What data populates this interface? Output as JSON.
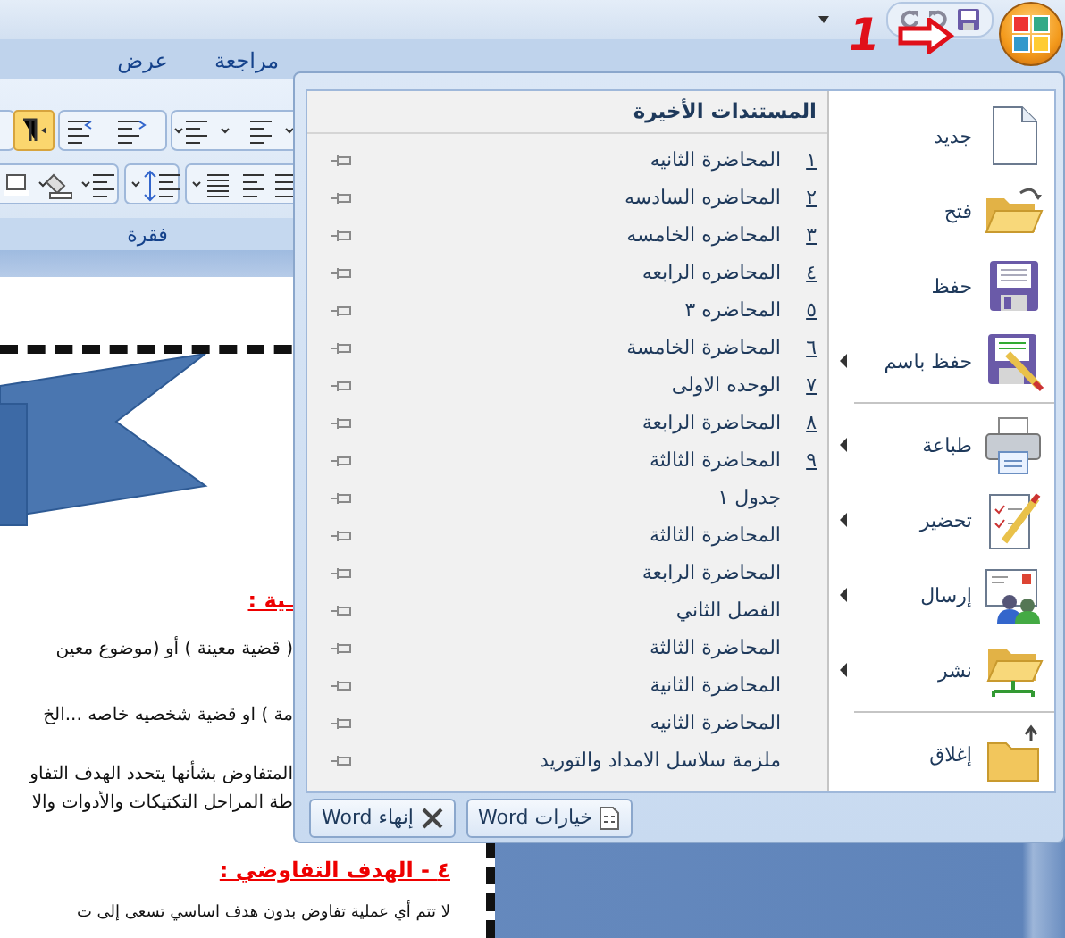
{
  "title_bar": {
    "annotation": "1"
  },
  "ribbon": {
    "tabs": [
      {
        "label": "مراجعة",
        "selected": false
      },
      {
        "label": "عرض",
        "selected": false
      }
    ],
    "group_label": "فقرة"
  },
  "document": {
    "partly_hidden": [
      {
        "kind": "heading",
        "text": "ـية :"
      },
      {
        "kind": "paragraph",
        "text": "( قضية معينة ) أو (موضوع معين"
      },
      {
        "kind": "paragraph",
        "text": "مة ) او قضية شخصيه خاصه ...الخ"
      },
      {
        "kind": "paragraph",
        "text": "المتفاوض بشأنها يتحدد الهدف التفاو"
      },
      {
        "kind": "paragraph",
        "text": "طة المراحل التكتيكات والأدوات والا"
      }
    ],
    "visible": [
      {
        "kind": "heading",
        "text": "٤ - الهدف التفاوضي :"
      },
      {
        "kind": "paragraph",
        "text": "لا تتم أي عملية تفاوض بدون هدف اساسي تسعى إلى ت"
      }
    ]
  },
  "office_menu": {
    "commands": [
      {
        "kind": "new",
        "label": "جديد",
        "submenu": false,
        "separator_after": false
      },
      {
        "kind": "open",
        "label": "فتح",
        "submenu": false,
        "separator_after": false
      },
      {
        "kind": "save",
        "label": "حفظ",
        "submenu": false,
        "separator_after": false
      },
      {
        "kind": "save_as",
        "label": "حفظ باسم",
        "submenu": true,
        "separator_after": true
      },
      {
        "kind": "print",
        "label": "طباعة",
        "submenu": true,
        "separator_after": false
      },
      {
        "kind": "prepare",
        "label": "تحضير",
        "submenu": true,
        "separator_after": false
      },
      {
        "kind": "send",
        "label": "إرسال",
        "submenu": true,
        "separator_after": false
      },
      {
        "kind": "publish",
        "label": "نشر",
        "submenu": true,
        "separator_after": true
      },
      {
        "kind": "close",
        "label": "إغلاق",
        "submenu": false,
        "separator_after": false
      }
    ],
    "recent_title": "المستندات الأخيرة",
    "recent": [
      {
        "number": "١",
        "name": "المحاضرة الثانيه",
        "pinned": false
      },
      {
        "number": "٢",
        "name": "المحاضره السادسه",
        "pinned": false
      },
      {
        "number": "٣",
        "name": "المحاضره الخامسه",
        "pinned": false
      },
      {
        "number": "٤",
        "name": "المحاضره الرابعه",
        "pinned": false
      },
      {
        "number": "٥",
        "name": "المحاضره ٣",
        "pinned": false
      },
      {
        "number": "٦",
        "name": "المحاضرة الخامسة",
        "pinned": false
      },
      {
        "number": "٧",
        "name": "الوحده الاولى",
        "pinned": false
      },
      {
        "number": "٨",
        "name": "المحاضرة الرابعة",
        "pinned": false
      },
      {
        "number": "٩",
        "name": "المحاضرة الثالثة",
        "pinned": false
      },
      {
        "name": "جدول ١",
        "pinned": false
      },
      {
        "name": "المحاضرة الثالثة",
        "pinned": false
      },
      {
        "name": "المحاضرة الرابعة",
        "pinned": false
      },
      {
        "name": "الفصل الثاني",
        "pinned": false
      },
      {
        "name": "المحاضرة الثالثة",
        "pinned": false
      },
      {
        "name": "المحاضرة الثانية",
        "pinned": false
      },
      {
        "name": "المحاضرة الثانيه",
        "pinned": false
      },
      {
        "name": "ملزمة سلاسل الامداد والتوريد",
        "pinned": false
      }
    ],
    "footer_buttons": [
      {
        "kind": "options",
        "label": "خيارات Word"
      },
      {
        "kind": "exit",
        "label": "إنهاء Word"
      }
    ]
  }
}
